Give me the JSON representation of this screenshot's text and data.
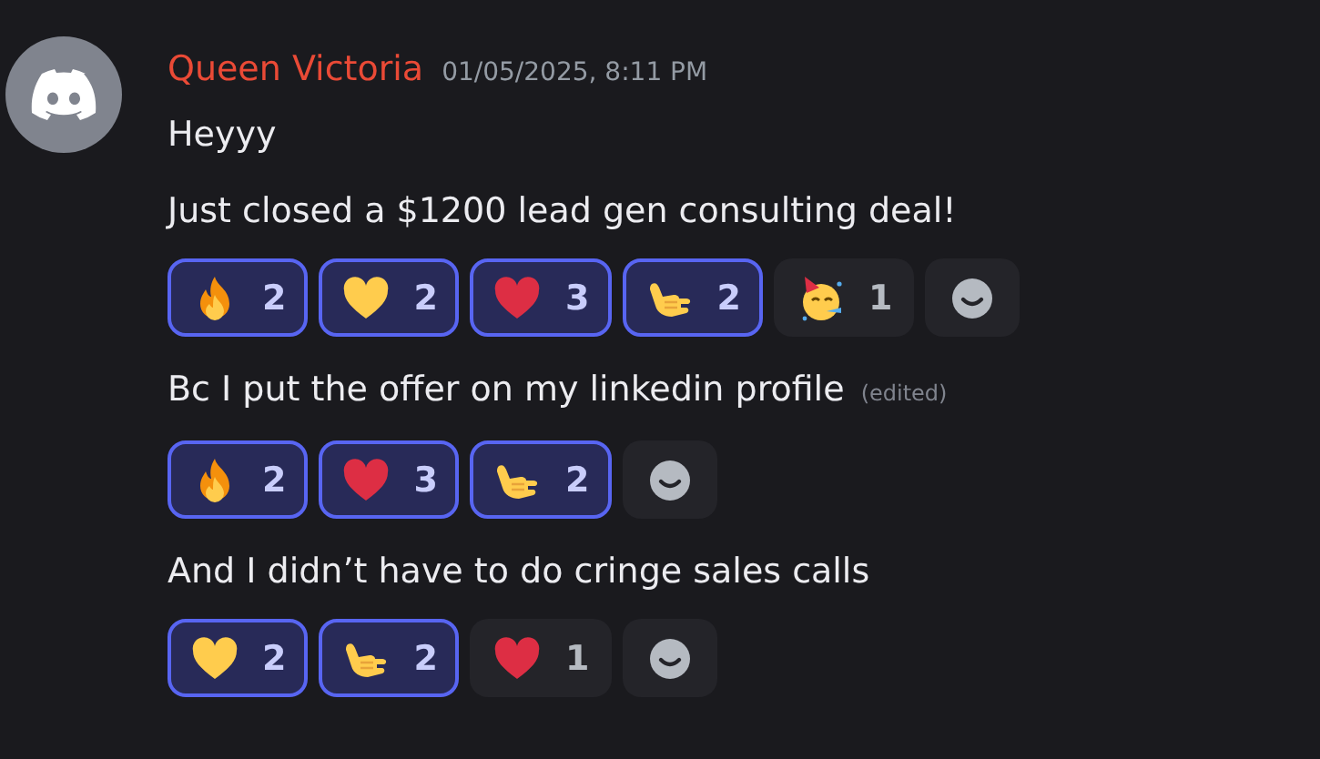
{
  "author": {
    "name": "Queen Victoria",
    "timestamp": "01/05/2025, 8:11 PM"
  },
  "messages": [
    {
      "text": "Heyyy"
    },
    {
      "text": "Just closed a $1200 lead gen consulting deal!",
      "reactions": [
        {
          "kind": "fire",
          "count": "2",
          "selected": true
        },
        {
          "kind": "yellow-heart",
          "count": "2",
          "selected": true
        },
        {
          "kind": "red-heart",
          "count": "3",
          "selected": true
        },
        {
          "kind": "call-me-hand",
          "count": "2",
          "selected": true
        },
        {
          "kind": "party-face",
          "count": "1",
          "selected": false
        }
      ]
    },
    {
      "text": "Bc I put the offer on my linkedin profile",
      "edited": "(edited)",
      "reactions": [
        {
          "kind": "fire",
          "count": "2",
          "selected": true
        },
        {
          "kind": "red-heart",
          "count": "3",
          "selected": true
        },
        {
          "kind": "call-me-hand",
          "count": "2",
          "selected": true
        }
      ]
    },
    {
      "text": "And I didn’t have to do cringe sales calls",
      "reactions": [
        {
          "kind": "yellow-heart",
          "count": "2",
          "selected": true
        },
        {
          "kind": "call-me-hand",
          "count": "2",
          "selected": true
        },
        {
          "kind": "red-heart",
          "count": "1",
          "selected": false
        }
      ]
    }
  ]
}
